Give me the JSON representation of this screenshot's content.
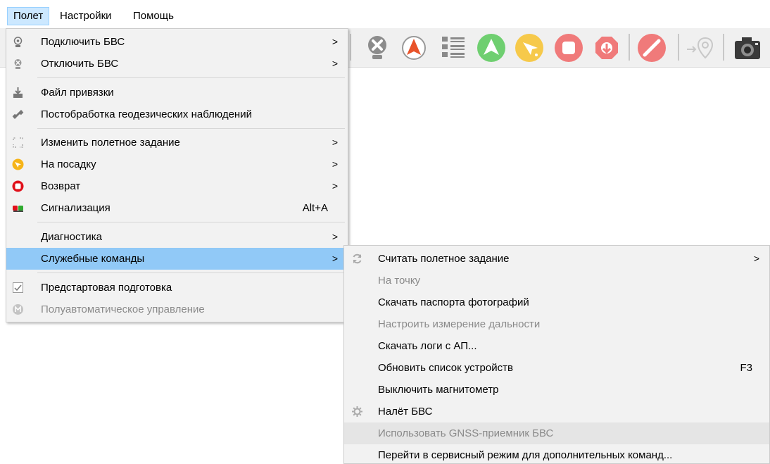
{
  "menubar": [
    {
      "label": "Полет",
      "active": true
    },
    {
      "label": "Настройки",
      "active": false
    },
    {
      "label": "Помощь",
      "active": false
    }
  ],
  "toolbar": {
    "buttons": [
      "disconnect-icon",
      "compass-icon",
      "list-icon",
      "takeoff-icon",
      "landing-icon",
      "stop-icon",
      "down-icon",
      "link-icon",
      "waypoint-icon",
      "camera-icon"
    ],
    "colors": {
      "green": "#6fcf70",
      "yellow": "#f6c94a",
      "red": "#f07a7a",
      "darkred": "#d94848"
    }
  },
  "main_menu": {
    "items": [
      {
        "label": "Подключить БВС",
        "icon": "antenna-connect-icon",
        "submenu": true,
        "accel": "",
        "disabled": false
      },
      {
        "label": "Отключить БВС",
        "icon": "antenna-disconnect-icon",
        "submenu": true,
        "accel": "",
        "disabled": false
      },
      {
        "label": "Файл привязки",
        "icon": "download-icon",
        "submenu": false,
        "accel": "",
        "disabled": false
      },
      {
        "label": "Постобработка геодезических наблюдений",
        "icon": "satellite-icon",
        "submenu": false,
        "accel": "",
        "disabled": false
      },
      {
        "label": "Изменить полетное задание",
        "icon": "route-edit-icon",
        "submenu": true,
        "accel": "",
        "disabled": false
      },
      {
        "label": "На посадку",
        "icon": "landing-icon",
        "submenu": true,
        "accel": "",
        "disabled": false
      },
      {
        "label": "Возврат",
        "icon": "return-icon",
        "submenu": true,
        "accel": "",
        "disabled": false
      },
      {
        "label": "Сигнализация",
        "icon": "alarm-icon",
        "submenu": false,
        "accel": "Alt+A",
        "disabled": false
      },
      {
        "label": "Диагностика",
        "icon": "",
        "submenu": true,
        "accel": "",
        "disabled": false
      },
      {
        "label": "Служебные команды",
        "icon": "",
        "submenu": true,
        "accel": "",
        "disabled": false,
        "highlighted": true
      },
      {
        "label": "Предстартовая подготовка",
        "icon": "checkbox-icon",
        "submenu": false,
        "accel": "",
        "disabled": false
      },
      {
        "label": "Полуавтоматическое управление",
        "icon": "manual-mode-icon",
        "submenu": false,
        "accel": "",
        "disabled": true
      }
    ],
    "arrow": ">"
  },
  "sub_menu": {
    "items": [
      {
        "label": "Считать полетное задание",
        "icon": "refresh-icon",
        "submenu": true,
        "accel": "",
        "disabled": false
      },
      {
        "label": "На точку",
        "icon": "",
        "submenu": false,
        "accel": "",
        "disabled": true
      },
      {
        "label": "Скачать паспорта фотографий",
        "icon": "",
        "submenu": false,
        "accel": "",
        "disabled": false
      },
      {
        "label": "Настроить измерение дальности",
        "icon": "",
        "submenu": false,
        "accel": "",
        "disabled": true
      },
      {
        "label": "Скачать логи с АП...",
        "icon": "",
        "submenu": false,
        "accel": "",
        "disabled": false
      },
      {
        "label": "Обновить список устройств",
        "icon": "",
        "submenu": false,
        "accel": "F3",
        "disabled": false
      },
      {
        "label": "Выключить магнитометр",
        "icon": "",
        "submenu": false,
        "accel": "",
        "disabled": false
      },
      {
        "label": "Налёт БВС",
        "icon": "gear-icon",
        "submenu": false,
        "accel": "",
        "disabled": false
      },
      {
        "label": "Использовать GNSS-приемник БВС",
        "icon": "",
        "submenu": false,
        "accel": "",
        "disabled": true,
        "hover": true
      },
      {
        "label": "Перейти в сервисный режим для дополнительных команд...",
        "icon": "",
        "submenu": false,
        "accel": "",
        "disabled": false
      }
    ],
    "arrow": ">"
  }
}
